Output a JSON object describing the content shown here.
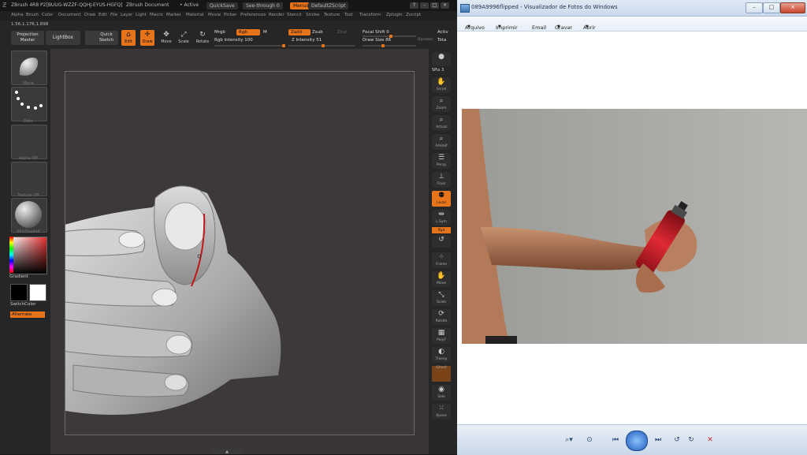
{
  "zbrush": {
    "title": {
      "app": "ZBrush 4R8 P2[BUUG-WZZF-QQHJ-EYUS-HGFQ]",
      "document": "ZBrush Document",
      "active": "• Active",
      "quicksave": "QuickSave",
      "seethrough": "See-through  0",
      "menus": "Menus",
      "defaultzscript": "DefaultZScript"
    },
    "menu": [
      "Alpha",
      "Brush",
      "Color",
      "Document",
      "Draw",
      "Edit",
      "File",
      "Layer",
      "Light",
      "Macro",
      "Marker",
      "Material",
      "Movie",
      "Picker",
      "Preferences",
      "Render",
      "Stencil",
      "Stroke",
      "Texture",
      "Tool",
      "Transform",
      "Zplugin",
      "Zscript"
    ],
    "toolbar": {
      "coords": "1.56,1.176,1.898",
      "projection": "Projection\nMaster",
      "lightbox": "LightBox",
      "quicksketch": "Quick\nSketch",
      "edit": "Edit",
      "draw": "Draw",
      "move": "Move",
      "scale": "Scale",
      "rotate": "Rotate",
      "mrgb": "Mrgb",
      "rgb": "Rgb",
      "m": "M",
      "zadd": "Zadd",
      "zsub": "Zsub",
      "zcut": "Zcut",
      "rgb_intensity": "Rgb Intensity 100",
      "z_intensity": "Z Intensity 51",
      "focal_shift": "Focal Shift 0",
      "draw_size": "Draw Size 86",
      "dynamic": "Dynamic",
      "active_points": "Activ",
      "total_points": "Tota"
    },
    "left_shelf": {
      "brush_cap": "Move",
      "stroke_cap": "Dots",
      "alpha_cap": "Alpha Off",
      "texture_cap": "Texture Off",
      "material_cap": "SkinShade4",
      "gradient": "Gradient",
      "switchcolor": "SwitchColor",
      "alternate": "Alternate"
    },
    "right_shelf": {
      "spix": "SPix 3",
      "buttons": [
        "Scroll",
        "Zoom",
        "Actual",
        "AAHalf",
        "Persp",
        "Floor",
        "Local",
        "L.Sym",
        "Xyz",
        "Frame",
        "Move",
        "Scale",
        "Rotate",
        "PolyF",
        "Transp",
        "Ghost",
        "Solo",
        "Xpose"
      ]
    },
    "colors": {
      "accent": "#e8741a",
      "bg": "#2b2b2b",
      "canvas": "#3a3536"
    }
  },
  "viewer": {
    "title": "089A9996flipped - Visualizador de Fotos do Windows",
    "menu": [
      "Arquivo",
      "Imprimir",
      "Email",
      "Gravar",
      "Abrir"
    ],
    "controls": [
      "zoom-icon",
      "fit-icon",
      "previous-icon",
      "slideshow-icon",
      "next-icon",
      "rotate-left-icon",
      "rotate-right-icon",
      "delete-icon"
    ],
    "colors": {
      "photo_bg": "#a8a9a4",
      "can": "#c8202a"
    }
  }
}
